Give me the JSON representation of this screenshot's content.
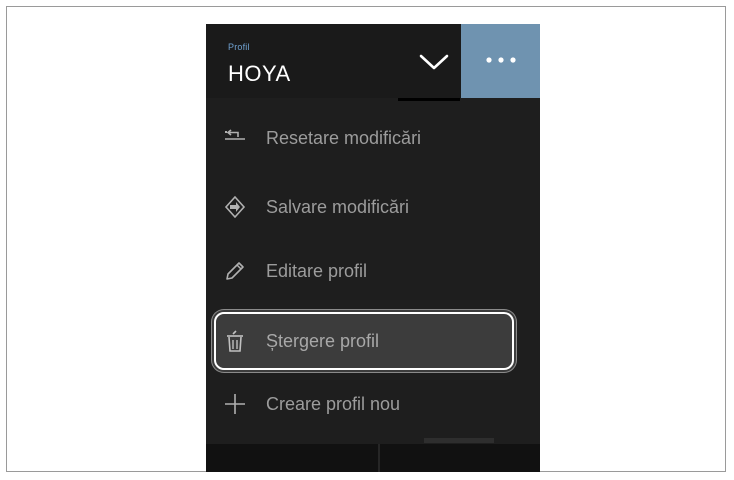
{
  "header": {
    "caption": "Profil",
    "profile_name": "HOYA"
  },
  "menu": {
    "items": [
      {
        "label": "Resetare modificări",
        "icon": "reset-icon"
      },
      {
        "label": "Salvare modificări",
        "icon": "save-icon"
      },
      {
        "label": "Editare profil",
        "icon": "pencil-icon"
      },
      {
        "label": "Ștergere profil",
        "icon": "trash-icon",
        "selected": true
      },
      {
        "label": "Creare profil nou",
        "icon": "plus-icon"
      }
    ]
  },
  "colors": {
    "panel_bg": "#1e1e1e",
    "accent_button": "#6f93b0",
    "caption": "#6fa0cf",
    "menu_text": "#9c9c9c",
    "selected_bg": "#3c3c3c"
  }
}
